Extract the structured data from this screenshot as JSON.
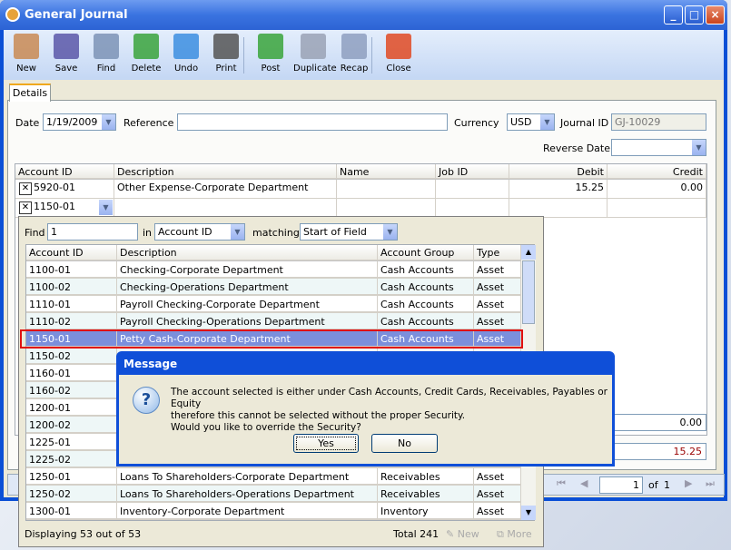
{
  "window": {
    "title": "General Journal",
    "controls": [
      "_",
      "□",
      "×"
    ]
  },
  "toolbar": [
    {
      "label": "New",
      "icon": "new-icon",
      "color": "#c98a53"
    },
    {
      "label": "Save",
      "icon": "save-icon",
      "color": "#5a57a8"
    },
    {
      "label": "Find",
      "icon": "find-icon",
      "color": "#7c93b6"
    },
    {
      "label": "Delete",
      "icon": "recycle-bin-icon",
      "color": "#3aa33c"
    },
    {
      "label": "Undo",
      "icon": "undo-icon",
      "color": "#3c8ee0"
    },
    {
      "label": "Print",
      "icon": "print-icon",
      "color": "#555"
    },
    {
      "label": "Post",
      "icon": "post-icon",
      "color": "#39a53b"
    },
    {
      "label": "Duplicate",
      "icon": "duplicate-icon",
      "color": "#9aa2b5"
    },
    {
      "label": "Recap",
      "icon": "recap-icon",
      "color": "#8e9fc0"
    },
    {
      "label": "Close",
      "icon": "close-doc-icon",
      "color": "#e04a23"
    }
  ],
  "tab": "Details",
  "form": {
    "date_label": "Date",
    "date": "1/19/2009",
    "reference_label": "Reference",
    "reference": "",
    "currency_label": "Currency",
    "currency": "USD",
    "journal_id_label": "Journal ID",
    "journal_id": "GJ-10029",
    "reverse_date_label": "Reverse Date",
    "reverse_date": ""
  },
  "grid": {
    "headers": [
      "Account ID",
      "Description",
      "Name",
      "Job ID",
      "Debit",
      "Credit"
    ],
    "rows": [
      {
        "account": "5920-01",
        "description": "Other Expense-Corporate Department",
        "name": "",
        "job": "",
        "debit": "15.25",
        "credit": "0.00"
      },
      {
        "account": "1150-01",
        "description": "",
        "name": "",
        "job": "",
        "debit": "",
        "credit": ""
      }
    ],
    "total_credit": "0.00",
    "difference": "15.25"
  },
  "pager": {
    "page": "1",
    "of_label": "of",
    "total_pages": "1"
  },
  "lookup": {
    "find_label": "Find",
    "find_value": "1",
    "in_label": "in",
    "in_value": "Account ID",
    "matching_label": "matching",
    "matching_value": "Start of Field",
    "headers": [
      "Account ID",
      "Description",
      "Account Group",
      "Type"
    ],
    "rows": [
      {
        "id": "1100-01",
        "desc": "Checking-Corporate Department",
        "group": "Cash Accounts",
        "type": "Asset"
      },
      {
        "id": "1100-02",
        "desc": "Checking-Operations Department",
        "group": "Cash Accounts",
        "type": "Asset"
      },
      {
        "id": "1110-01",
        "desc": "Payroll Checking-Corporate Department",
        "group": "Cash Accounts",
        "type": "Asset"
      },
      {
        "id": "1110-02",
        "desc": "Payroll Checking-Operations Department",
        "group": "Cash Accounts",
        "type": "Asset"
      },
      {
        "id": "1150-01",
        "desc": "Petty Cash-Corporate Department",
        "group": "Cash Accounts",
        "type": "Asset",
        "selected": true
      },
      {
        "id": "1150-02",
        "desc": "",
        "group": "",
        "type": ""
      },
      {
        "id": "1160-01",
        "desc": "",
        "group": "",
        "type": ""
      },
      {
        "id": "1160-02",
        "desc": "",
        "group": "",
        "type": ""
      },
      {
        "id": "1200-01",
        "desc": "",
        "group": "",
        "type": ""
      },
      {
        "id": "1200-02",
        "desc": "",
        "group": "",
        "type": ""
      },
      {
        "id": "1225-01",
        "desc": "",
        "group": "",
        "type": ""
      },
      {
        "id": "1225-02",
        "desc": "",
        "group": "",
        "type": ""
      },
      {
        "id": "1250-01",
        "desc": "Loans To Shareholders-Corporate Department",
        "group": "Receivables",
        "type": "Asset"
      },
      {
        "id": "1250-02",
        "desc": "Loans To Shareholders-Operations Department",
        "group": "Receivables",
        "type": "Asset"
      },
      {
        "id": "1300-01",
        "desc": "Inventory-Corporate Department",
        "group": "Inventory",
        "type": "Asset"
      }
    ],
    "status": "Displaying 53 out of 53",
    "total": "Total 241",
    "new_label": "New",
    "more_label": "More"
  },
  "dialog": {
    "title": "Message",
    "lines": [
      "The account selected is either under Cash Accounts, Credit Cards, Receivables, Payables or Equity",
      "therefore this cannot be selected without the proper Security.",
      "Would you like to override the Security?"
    ],
    "yes": "Yes",
    "no": "No",
    "icon": "question-icon"
  }
}
